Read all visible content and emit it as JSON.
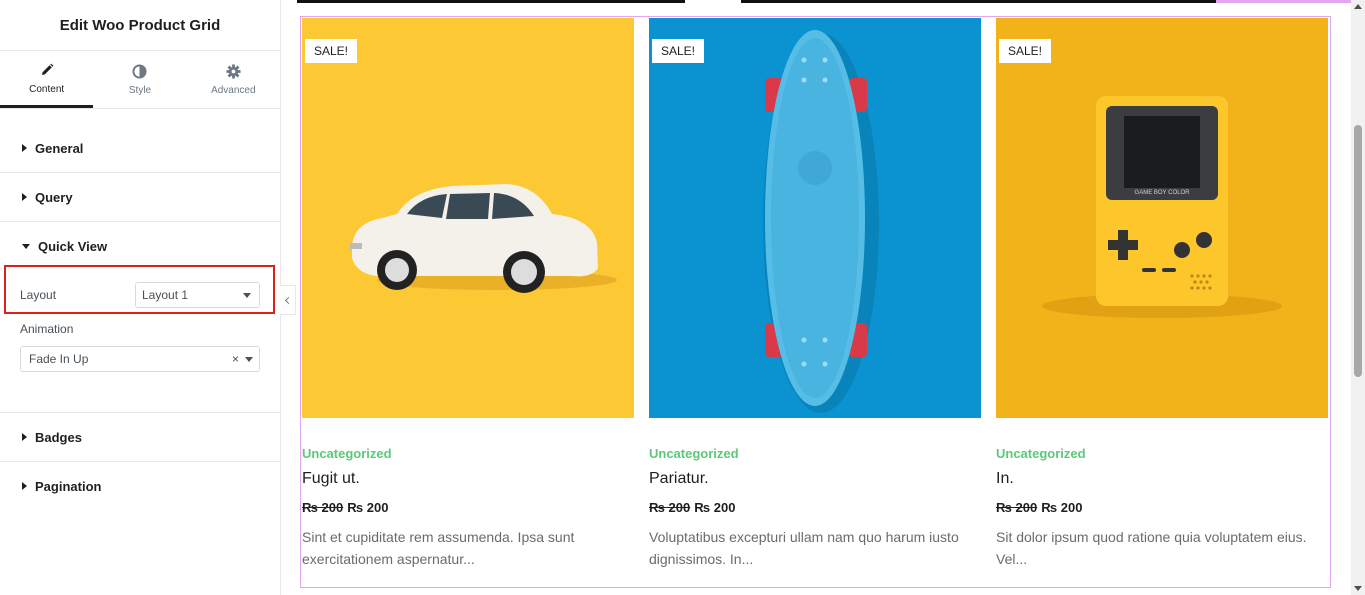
{
  "panel": {
    "title": "Edit Woo Product Grid",
    "tabs": [
      {
        "label": "Content",
        "icon": "pencil-icon",
        "active": true
      },
      {
        "label": "Style",
        "icon": "contrast-icon",
        "active": false
      },
      {
        "label": "Advanced",
        "icon": "gear-icon",
        "active": false
      }
    ],
    "sections": {
      "general": "General",
      "query": "Query",
      "quick_view": "Quick View",
      "badges": "Badges",
      "pagination": "Pagination"
    },
    "quick_view": {
      "layout_label": "Layout",
      "layout_value": "Layout 1",
      "animation_label": "Animation",
      "animation_value": "Fade In Up",
      "clear_symbol": "×"
    }
  },
  "colors": {
    "category": "#5cc878",
    "preview_border": "#e3a6ee",
    "highlight": "#e0201c",
    "card1_bg": "#fcc934",
    "card2_bg": "#0a93d0",
    "card3_bg": "#f2b21a"
  },
  "products": [
    {
      "badge": "SALE!",
      "category": "Uncategorized",
      "name": "Fugit ut.",
      "old_price": "₨ 200",
      "price": "₨ 200",
      "description": "Sint et cupiditate rem assumenda. Ipsa sunt exercitationem aspernatur...",
      "image": "toy-car-image"
    },
    {
      "badge": "SALE!",
      "category": "Uncategorized",
      "name": "Pariatur.",
      "old_price": "₨ 200",
      "price": "₨ 200",
      "description": "Voluptatibus excepturi ullam nam quo harum iusto dignissimos. In...",
      "image": "skateboard-image"
    },
    {
      "badge": "SALE!",
      "category": "Uncategorized",
      "name": "In.",
      "old_price": "₨ 200",
      "price": "₨ 200",
      "description": "Sit dolor ipsum quod ratione quia voluptatem eius. Vel...",
      "image": "handheld-console-image"
    }
  ],
  "console_brand": "GAME BOY COLOR"
}
